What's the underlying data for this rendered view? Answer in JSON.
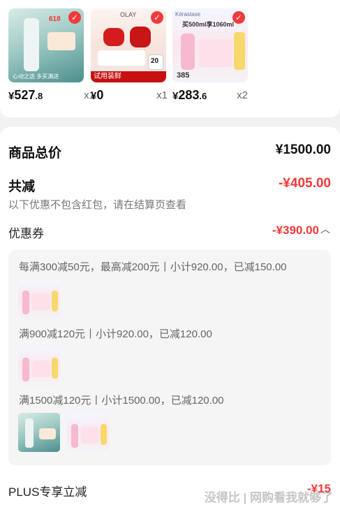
{
  "products": [
    {
      "price_main": "527",
      "price_decimal": ".8",
      "qty": "x1",
      "badge": "618",
      "caption": "心动之选 多买满送"
    },
    {
      "price_main": "0",
      "price_decimal": "",
      "qty": "x1",
      "brand": "OLAY",
      "tag": "试用装鲜",
      "badge": "20"
    },
    {
      "price_main": "283",
      "price_decimal": ".6",
      "qty": "x2",
      "brand": "Kérastase",
      "promo": "买500ml享1060ml",
      "num": "385"
    }
  ],
  "currency": "¥",
  "summary": {
    "total_label": "商品总价",
    "total_value": "¥1500.00",
    "discount_label": "共减",
    "discount_value": "-¥405.00",
    "note": "以下优惠不包含红包，请在结算页查看",
    "coupon_label": "优惠券",
    "coupon_value": "-¥390.00",
    "coupon_chevron": "chevron-up-icon"
  },
  "coupon_rules": [
    "每满300减50元，最高减200元丨小计920.00，已减150.00",
    "满900减120元丨小计920.00，已减120.00",
    "满1500减120元丨小计1500.00，已减120.00"
  ],
  "plus": {
    "label": "PLUS专享立减",
    "value": "-¥15"
  },
  "watermark": "没得比 | 网购看我就够了",
  "colors": {
    "accent": "#f23a3a",
    "text": "#1a1a1a",
    "muted": "#777777",
    "check": "#f23a3a"
  }
}
